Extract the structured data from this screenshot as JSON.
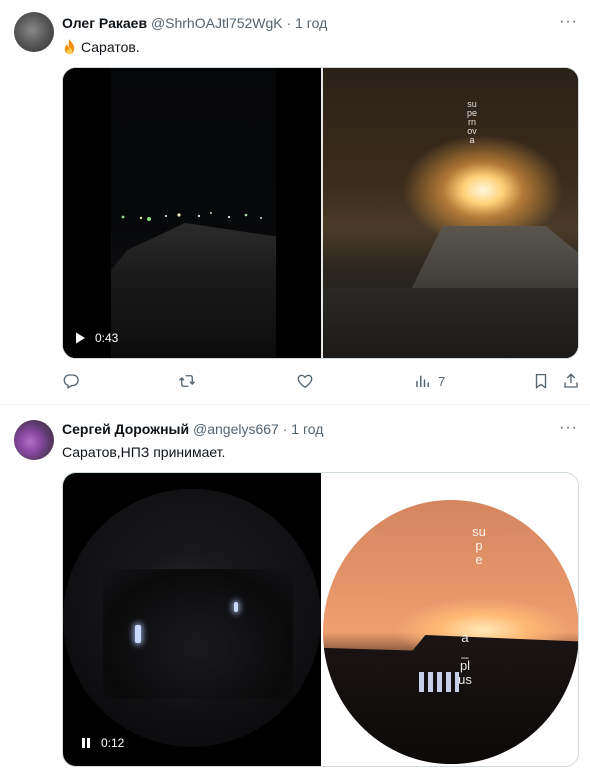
{
  "tweets": [
    {
      "author_name": "Олег Ракаев",
      "handle": "@ShrhOAJtl752WgK",
      "separator": "·",
      "time": "1 год",
      "more": "···",
      "text": "Саратов.",
      "media": {
        "duration": "0:43",
        "watermark": "supernova"
      },
      "actions": {
        "reply": "",
        "retweet": "",
        "like": "",
        "views": "7"
      }
    },
    {
      "author_name": "Сергей Дорожный",
      "handle": "@angelys667",
      "separator": "·",
      "time": "1 год",
      "more": "···",
      "text": "Саратов,НПЗ принимает.",
      "media": {
        "duration": "0:12",
        "watermark_top": "supe",
        "watermark_bottom": "a_plus"
      }
    }
  ],
  "icons": {
    "fire": "fire-emoji",
    "play": "play-icon",
    "pause": "pause-icon",
    "reply": "reply-icon",
    "retweet": "retweet-icon",
    "like": "heart-icon",
    "views": "views-icon",
    "bookmark": "bookmark-icon",
    "share": "share-icon"
  },
  "colors": {
    "text_primary": "#0f1419",
    "text_secondary": "#536471",
    "border": "#cfd9de"
  }
}
